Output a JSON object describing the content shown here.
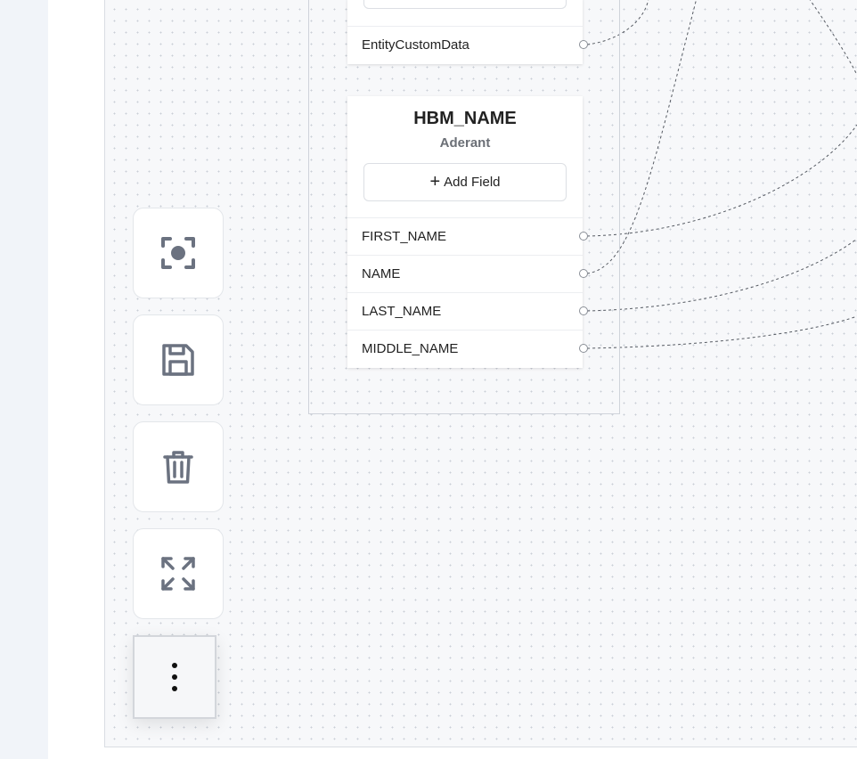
{
  "nodes": {
    "top": {
      "fields": [
        "EntityCustomData"
      ]
    },
    "main": {
      "title": "HBM_NAME",
      "subtitle": "Aderant",
      "add_field_label": "Add Field",
      "fields": [
        "FIRST_NAME",
        "NAME",
        "LAST_NAME",
        "MIDDLE_NAME"
      ]
    }
  },
  "toolbar": {
    "buttons": [
      {
        "name": "fit-view",
        "icon": "focus-target-icon"
      },
      {
        "name": "save",
        "icon": "floppy-disk-icon"
      },
      {
        "name": "delete",
        "icon": "trash-icon"
      },
      {
        "name": "expand",
        "icon": "expand-arrows-icon"
      }
    ],
    "more": {
      "icon": "vertical-ellipsis-icon"
    }
  },
  "colors": {
    "icon": "#6b7280",
    "edge": "#555a62",
    "canvas": "#f7f8fa"
  }
}
